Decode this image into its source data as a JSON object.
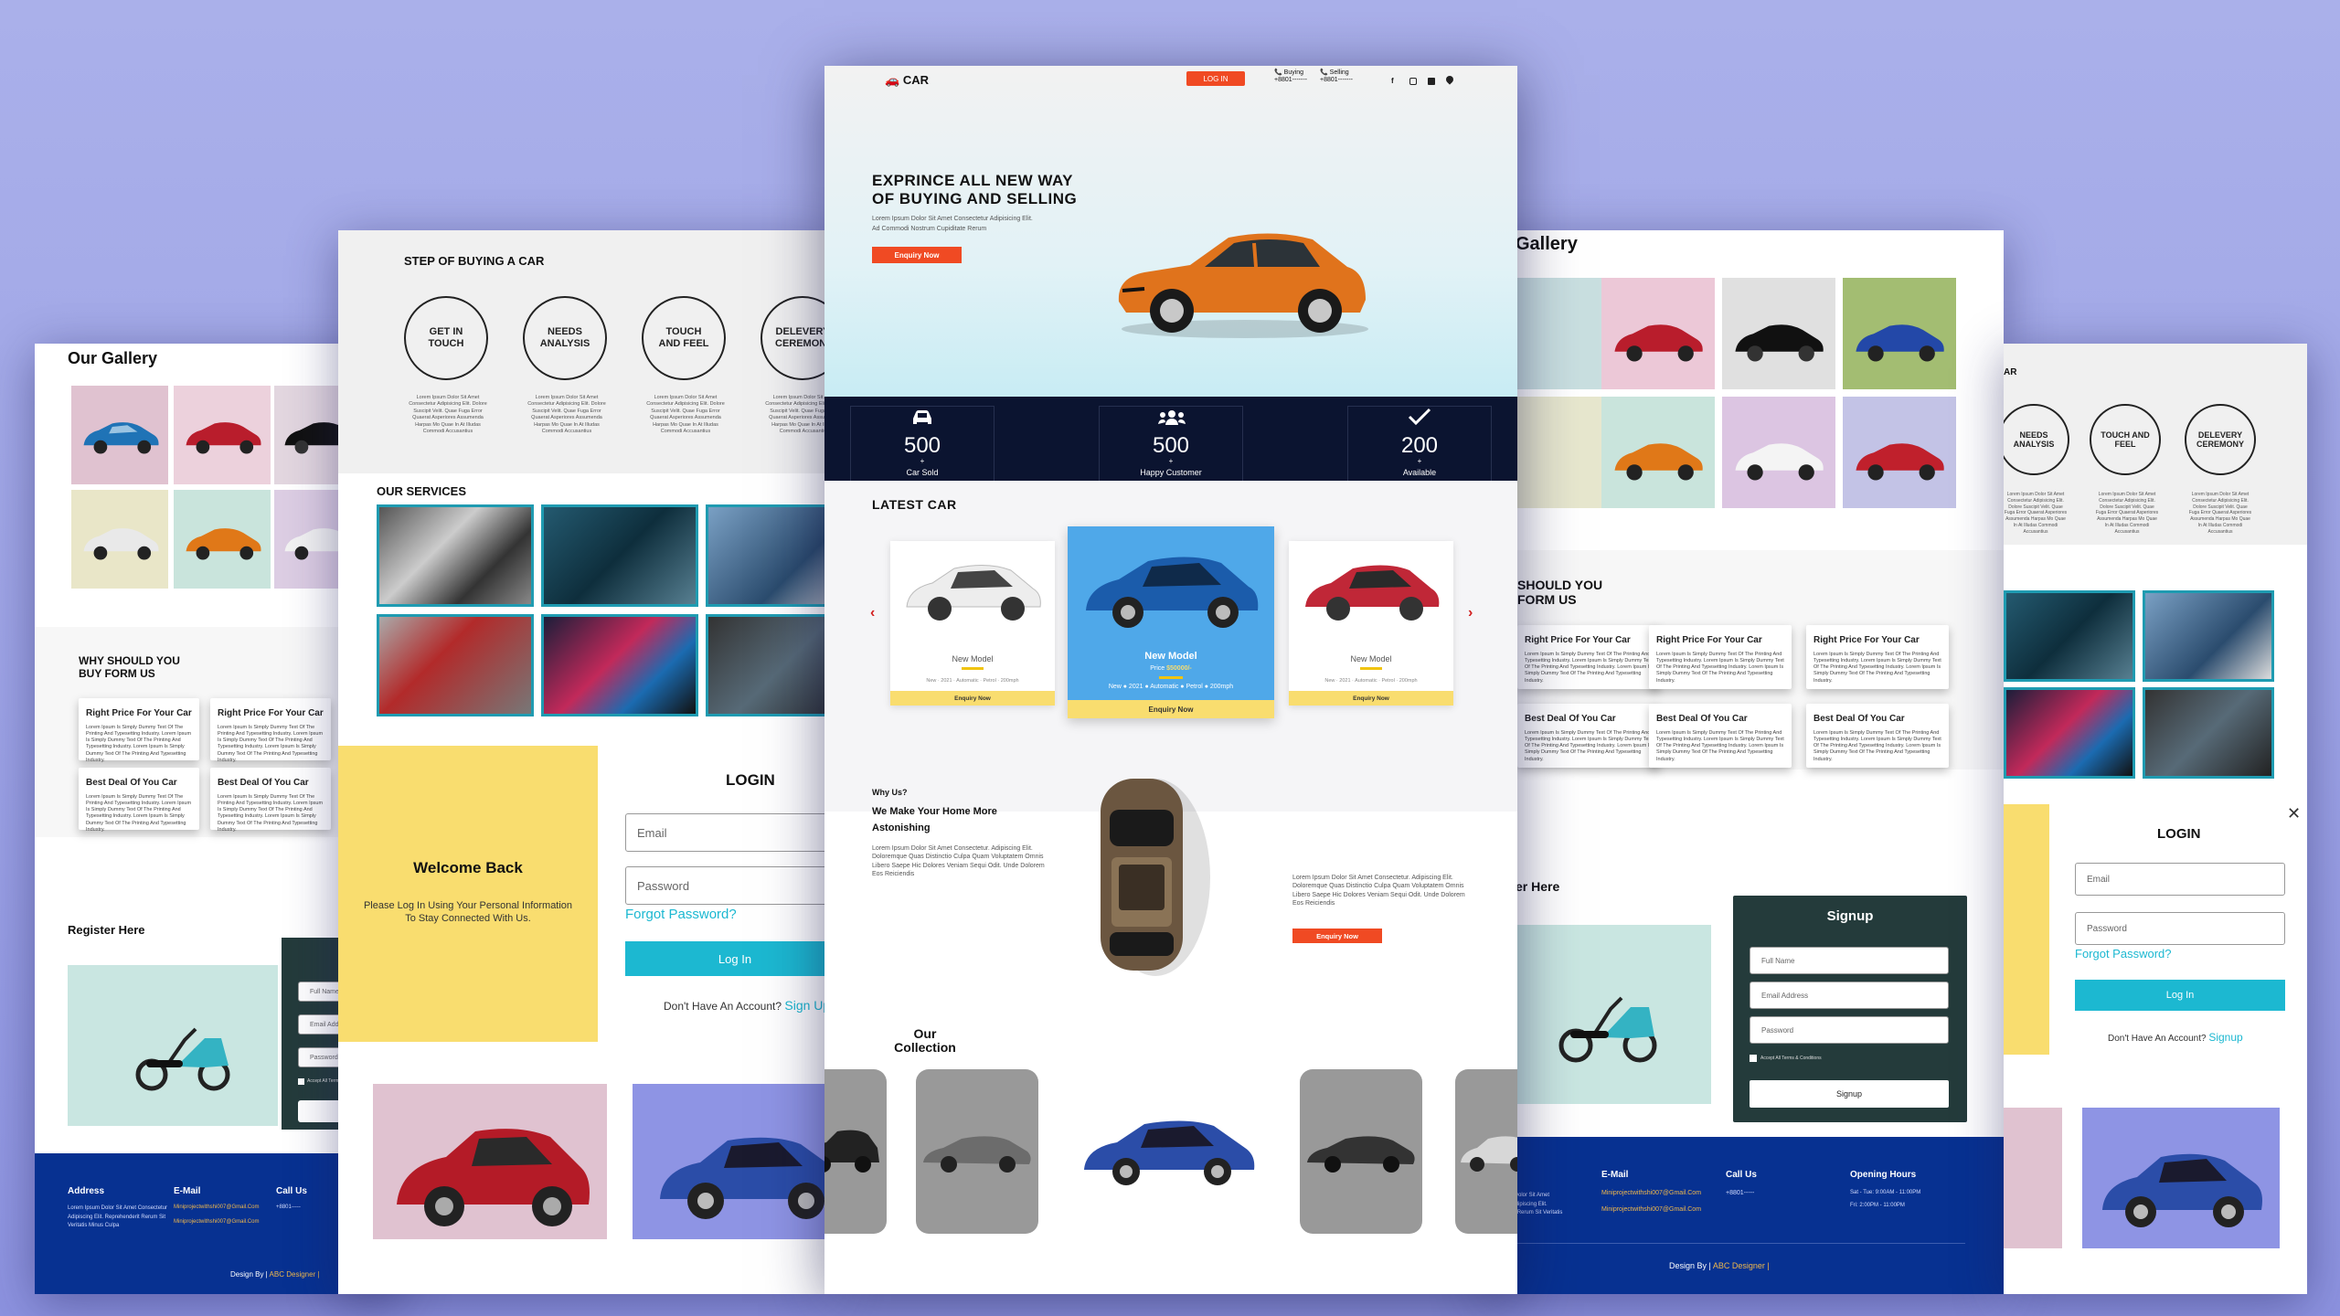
{
  "hero": {
    "logo": "CAR",
    "login": "LOG IN",
    "buying_label": "Buying",
    "buying_num": "+8801-------",
    "selling_label": "Selling",
    "selling_num": "+8801-------",
    "title1": "EXPRINCE ALL NEW WAY",
    "title2": "OF BUYING AND SELLING",
    "sub1": "Lorem Ipsum Dolor Sit Amet Consectetur Adipisicing Elit.",
    "sub2": "Ad Commodi Nostrum Cupiditate Rerum",
    "cta": "Enquiry Now"
  },
  "stats": [
    {
      "value": "500",
      "label": "Car Sold",
      "icon": "car-icon"
    },
    {
      "value": "500",
      "label": "Happy Customer",
      "icon": "users-icon"
    },
    {
      "value": "200",
      "label": "Available",
      "icon": "check-icon"
    }
  ],
  "latest": {
    "title": "LATEST CAR",
    "left": {
      "name": "New Model",
      "specs": "New  ·  2021  ·  Automatic  ·  Petrol  ·  200mph",
      "btn": "Enquiry Now"
    },
    "center": {
      "name": "New Model",
      "price_label": "Price",
      "price": "$50000/-",
      "specs": "New ● 2021 ● Automatic ● Petrol ● 200mph",
      "btn": "Enquiry Now"
    },
    "right": {
      "name": "New Model",
      "specs": "New  ·  2021  ·  Automatic  ·  Petrol  ·  200mph",
      "btn": "Enquiry Now"
    }
  },
  "why": {
    "small": "Why Us?",
    "title1": "We Make Your Home More",
    "title2": "Astonishing",
    "body": "Lorem Ipsum Dolor Sit Amet Consectetur. Adipiscing Elit. Doloremque Quas Distinctio Culpa Quam Voluptatem Omnis Libero Saepe Hic Dolores Veniam Sequi Odit. Unde Dolorem Eos Reiciendis",
    "body2": "Lorem Ipsum Dolor Sit Amet Consectetur. Adipiscing Elit. Doloremque Quas Distinctio Culpa Quam Voluptatem Omnis Libero Saepe Hic Dolores Veniam Sequi Odit. Unde Dolorem Eos Reiciendis",
    "cta": "Enquiry Now"
  },
  "collection": {
    "title1": "Our",
    "title2": "Collection"
  },
  "steps": {
    "title": "STEP OF BUYING A CAR",
    "items": [
      "GET IN TOUCH",
      "NEEDS ANALYSIS",
      "TOUCH AND FEEL",
      "DELEVERY CEREMONY"
    ],
    "desc": "Lorem Ipsum Dolor Sit Amet Consectetur Adipisicing Elit. Dolore Suscipit Velit. Quae Fuga Error Quaerat Asperiores Assumenda Harpas Mo Quae In At Illudas Commodi Accusantius",
    "items_r": [
      "NEEDS ANALYSIS",
      "TOUCH AND FEEL",
      "DELEVERY CEREMONY"
    ]
  },
  "services": {
    "title": "OUR SERVICES"
  },
  "login": {
    "welcome": "Welcome Back",
    "welcome_sub": "Please Log In Using Your Personal Information To Stay Connected With Us.",
    "title": "LOGIN",
    "email": "Email",
    "password": "Password",
    "forgot": "Forgot Password?",
    "btn": "Log In",
    "noacc": "Don't Have An Account?",
    "signup": "Sign Up",
    "signup_short": "Signup"
  },
  "gallery": {
    "title": "Our Gallery",
    "title_short": "Gallery"
  },
  "whyus": {
    "t1": "WHY SHOULD YOU",
    "t2": "BUY FORM US",
    "t1r": "SHOULD YOU",
    "t2r": "FORM US",
    "c1": "Right Price For Your Car",
    "c2": "Best Deal Of You Car",
    "body": "Lorem Ipsum Is Simply Dummy Text Of The Printing And Typesetting Industry. Lorem Ipsum Is Simply Dummy Text Of The Printing And Typesetting Industry. Lorem Ipsum Is Simply Dummy Text Of The Printing And Typesetting Industry."
  },
  "register": {
    "title": "Register Here",
    "title_r": "er Here",
    "signup_title": "Signup",
    "full": "Full Name",
    "email": "Email Address",
    "pass": "Password",
    "terms": "Accept All Terms & Conditions",
    "btn": "Signup"
  },
  "footer": {
    "address": "Address",
    "email": "E-Mail",
    "call": "Call Us",
    "hours": "Opening Hours",
    "addr_text": "Lorem Ipsum Dolor Sit Amet Consectetur Adipiscing Elit. Reprehenderit Rerum Sit Veritatis Minus Culpa",
    "mail1": "Miniprojectwithshi007@Gmail.Com",
    "mail2": "Miniprojectwithshi007@Gmail.Com",
    "phone": "+8801-----",
    "hours1": "Sat - Tue: 9:00AM - 11:00PM",
    "hours2": "Fri: 2:00PM - 11:00PM",
    "credit": "Design By |",
    "credit_link": "ABC Designer |"
  },
  "colors": {
    "accent": "#f04a23",
    "navy": "#0b1430",
    "cyan": "#1cb8d1",
    "yellow": "#f9dd6f",
    "blue": "#4fa8e9",
    "footer": "#073191"
  }
}
